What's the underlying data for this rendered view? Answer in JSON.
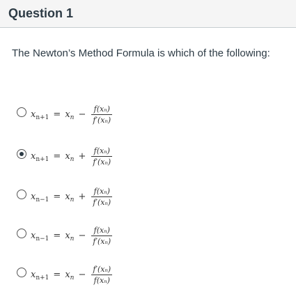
{
  "question": {
    "title": "Question 1",
    "prompt": "The Newton’s Method Formula is which of the following:"
  },
  "options": [
    {
      "selected": false,
      "lhs_sub": "n+1",
      "op": "−",
      "num": "f(xₙ)",
      "den": "f′(xₙ)"
    },
    {
      "selected": true,
      "lhs_sub": "n+1",
      "op": "+",
      "num": "f(xₙ)",
      "den": "f′(xₙ)"
    },
    {
      "selected": false,
      "lhs_sub": "n−1",
      "op": "+",
      "num": "f(xₙ)",
      "den": "f′(xₙ)"
    },
    {
      "selected": false,
      "lhs_sub": "n−1",
      "op": "−",
      "num": "f(xₙ)",
      "den": "f′(xₙ)"
    },
    {
      "selected": false,
      "lhs_sub": "n+1",
      "op": "−",
      "num": "f′(xₙ)",
      "den": "f(xₙ)"
    }
  ]
}
